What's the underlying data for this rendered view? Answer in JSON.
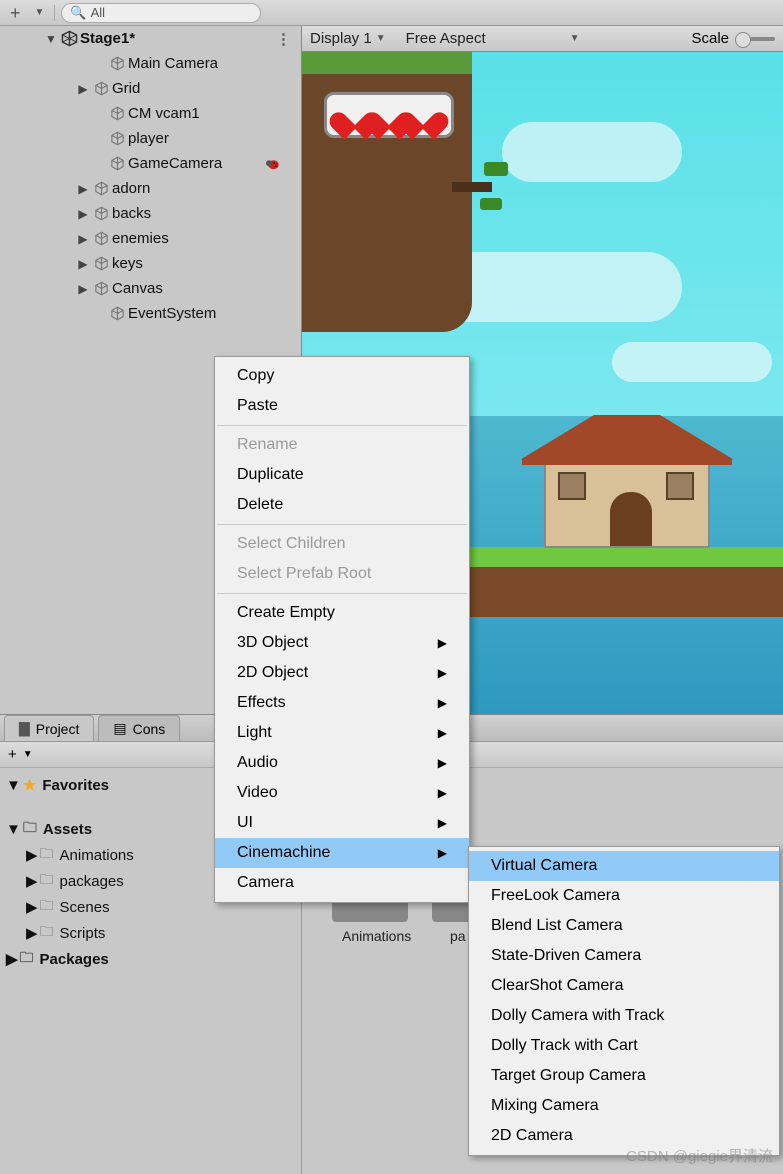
{
  "toolbar": {
    "search_label": "All"
  },
  "scene": {
    "name": "Stage1*",
    "items": [
      {
        "label": "Main Camera",
        "indent": 3,
        "expand": "none"
      },
      {
        "label": "Grid",
        "indent": 2,
        "expand": "closed"
      },
      {
        "label": "CM vcam1",
        "indent": 3,
        "expand": "none"
      },
      {
        "label": "player",
        "indent": 3,
        "expand": "none"
      },
      {
        "label": "GameCamera",
        "indent": 3,
        "expand": "none",
        "ladybug": true
      },
      {
        "label": "adorn",
        "indent": 2,
        "expand": "closed"
      },
      {
        "label": "backs",
        "indent": 2,
        "expand": "closed"
      },
      {
        "label": "enemies",
        "indent": 2,
        "expand": "closed"
      },
      {
        "label": "keys",
        "indent": 2,
        "expand": "closed"
      },
      {
        "label": "Canvas",
        "indent": 2,
        "expand": "closed"
      },
      {
        "label": "EventSystem",
        "indent": 3,
        "expand": "none"
      }
    ]
  },
  "gameview": {
    "display": "Display 1",
    "aspect": "Free Aspect",
    "scale_label": "Scale"
  },
  "tabs": {
    "project": "Project",
    "console": "Cons"
  },
  "project": {
    "favorites": "Favorites",
    "assets": "Assets",
    "assets_children": [
      "Animations",
      "packages",
      "Scenes",
      "Scripts"
    ],
    "packages": "Packages",
    "content_labels": [
      "Animations",
      "pa"
    ]
  },
  "context_menu": {
    "items": [
      {
        "label": "Copy",
        "type": "item"
      },
      {
        "label": "Paste",
        "type": "item"
      },
      {
        "type": "sep"
      },
      {
        "label": "Rename",
        "type": "disabled"
      },
      {
        "label": "Duplicate",
        "type": "item"
      },
      {
        "label": "Delete",
        "type": "item"
      },
      {
        "type": "sep"
      },
      {
        "label": "Select Children",
        "type": "disabled"
      },
      {
        "label": "Select Prefab Root",
        "type": "disabled"
      },
      {
        "type": "sep"
      },
      {
        "label": "Create Empty",
        "type": "item"
      },
      {
        "label": "3D Object",
        "type": "submenu"
      },
      {
        "label": "2D Object",
        "type": "submenu"
      },
      {
        "label": "Effects",
        "type": "submenu"
      },
      {
        "label": "Light",
        "type": "submenu"
      },
      {
        "label": "Audio",
        "type": "submenu"
      },
      {
        "label": "Video",
        "type": "submenu"
      },
      {
        "label": "UI",
        "type": "submenu"
      },
      {
        "label": "Cinemachine",
        "type": "submenu",
        "highlight": true
      },
      {
        "label": "Camera",
        "type": "item"
      }
    ]
  },
  "submenu": {
    "items": [
      {
        "label": "Virtual Camera",
        "highlight": true
      },
      {
        "label": "FreeLook Camera"
      },
      {
        "label": "Blend List Camera"
      },
      {
        "label": "State-Driven Camera"
      },
      {
        "label": "ClearShot Camera"
      },
      {
        "label": "Dolly Camera with Track"
      },
      {
        "label": "Dolly Track with Cart"
      },
      {
        "label": "Target Group Camera"
      },
      {
        "label": "Mixing Camera"
      },
      {
        "label": "2D Camera"
      }
    ]
  },
  "watermark": "CSDN @giegie界清流"
}
